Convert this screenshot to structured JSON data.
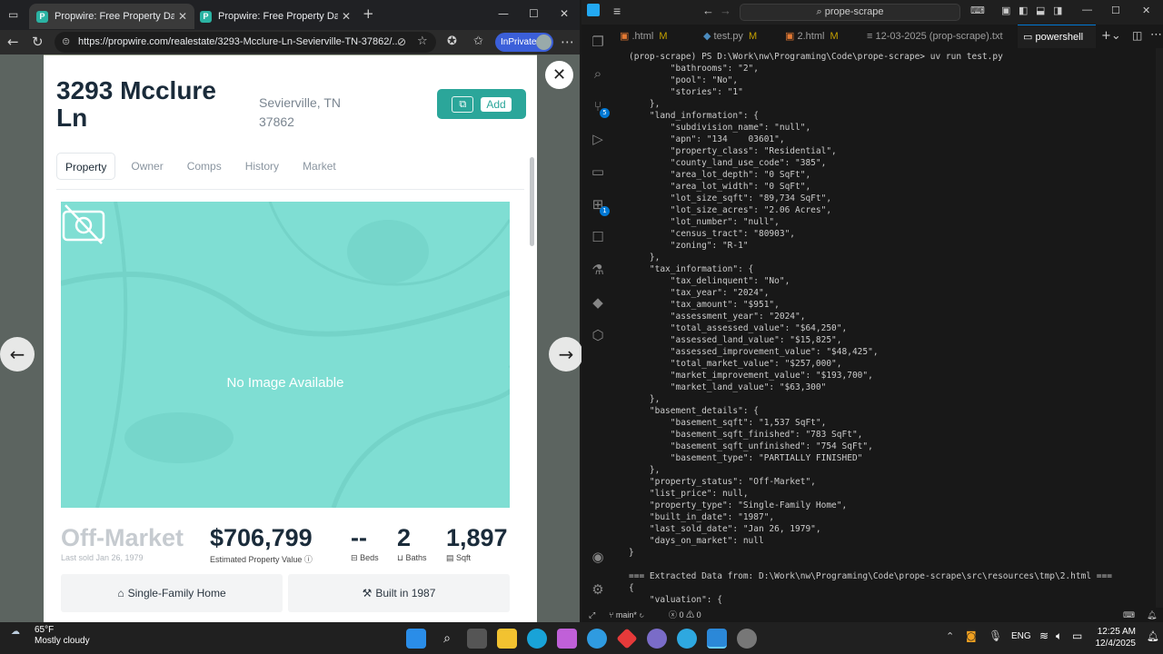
{
  "browser": {
    "tabs": [
      {
        "title": "Propwire: Free Property Data | Re"
      },
      {
        "title": "Propwire: Free Property Data | Re"
      }
    ],
    "url": "https://propwire.com/realestate/3293-Mcclure-Ln-Sevierville-TN-37862/...",
    "inprivate": "InPrivate",
    "new_tab": "+"
  },
  "property": {
    "title": "3293 Mcclure Ln",
    "city": "Sevierville, TN 37862",
    "add_label": "Add",
    "tabs": [
      "Property",
      "Owner",
      "Comps",
      "History",
      "Market"
    ],
    "no_image": "No Image Available",
    "status": "Off-Market",
    "last_sold": "Last sold Jan 26, 1979",
    "price": "$706,799",
    "price_label": "Estimated Property Value",
    "beds": "--",
    "beds_label": "Beds",
    "baths": "2",
    "baths_label": "Baths",
    "sqft": "1,897",
    "sqft_label": "Sqft",
    "type": "Single-Family Home",
    "built": "Built in 1987"
  },
  "vscode": {
    "search": "prope-scrape",
    "tabs": [
      {
        "name": ".html",
        "mark": "M"
      },
      {
        "name": "test.py",
        "mark": "M"
      },
      {
        "name": "2.html",
        "mark": "M"
      },
      {
        "name": "12-03-2025 (prop-scrape).txt",
        "mark": ""
      },
      {
        "name": "powershell",
        "mark": ""
      }
    ],
    "terminal": "(prop-scrape) PS D:\\Work\\nw\\Programing\\Code\\prope-scrape> uv run test.py\n        \"bathrooms\": \"2\",\n        \"pool\": \"No\",\n        \"stories\": \"1\"\n    },\n    \"land_information\": {\n        \"subdivision_name\": \"null\",\n        \"apn\": \"134    03601\",\n        \"property_class\": \"Residential\",\n        \"county_land_use_code\": \"385\",\n        \"area_lot_depth\": \"0 SqFt\",\n        \"area_lot_width\": \"0 SqFt\",\n        \"lot_size_sqft\": \"89,734 SqFt\",\n        \"lot_size_acres\": \"2.06 Acres\",\n        \"lot_number\": \"null\",\n        \"census_tract\": \"80903\",\n        \"zoning\": \"R-1\"\n    },\n    \"tax_information\": {\n        \"tax_delinquent\": \"No\",\n        \"tax_year\": \"2024\",\n        \"tax_amount\": \"$951\",\n        \"assessment_year\": \"2024\",\n        \"total_assessed_value\": \"$64,250\",\n        \"assessed_land_value\": \"$15,825\",\n        \"assessed_improvement_value\": \"$48,425\",\n        \"total_market_value\": \"$257,000\",\n        \"market_improvement_value\": \"$193,700\",\n        \"market_land_value\": \"$63,300\"\n    },\n    \"basement_details\": {\n        \"basement_sqft\": \"1,537 SqFt\",\n        \"basement_sqft_finished\": \"783 SqFt\",\n        \"basement_sqft_unfinished\": \"754 SqFt\",\n        \"basement_type\": \"PARTIALLY FINISHED\"\n    },\n    \"property_status\": \"Off-Market\",\n    \"list_price\": null,\n    \"property_type\": \"Single-Family Home\",\n    \"built_in_date\": \"1987\",\n    \"last_sold_date\": \"Jan 26, 1979\",\n    \"days_on_market\": null\n}\n\n=== Extracted Data from: D:\\Work\\nw\\Programing\\Code\\prope-scrape\\src\\resources\\tmp\\2.html ===\n{\n    \"valuation\": {",
    "status_branch": "main*",
    "status_problems": "0",
    "status_warnings": "0",
    "badge_scm": "5",
    "badge_ext": "1"
  },
  "taskbar": {
    "temp": "65°F",
    "weather": "Mostly cloudy",
    "lang": "ENG",
    "time": "12:25 AM",
    "date": "12/4/2025"
  },
  "colors": {
    "accent": "#2ba69a",
    "map": "#7fded3",
    "vscode_blue": "#0078d4"
  }
}
